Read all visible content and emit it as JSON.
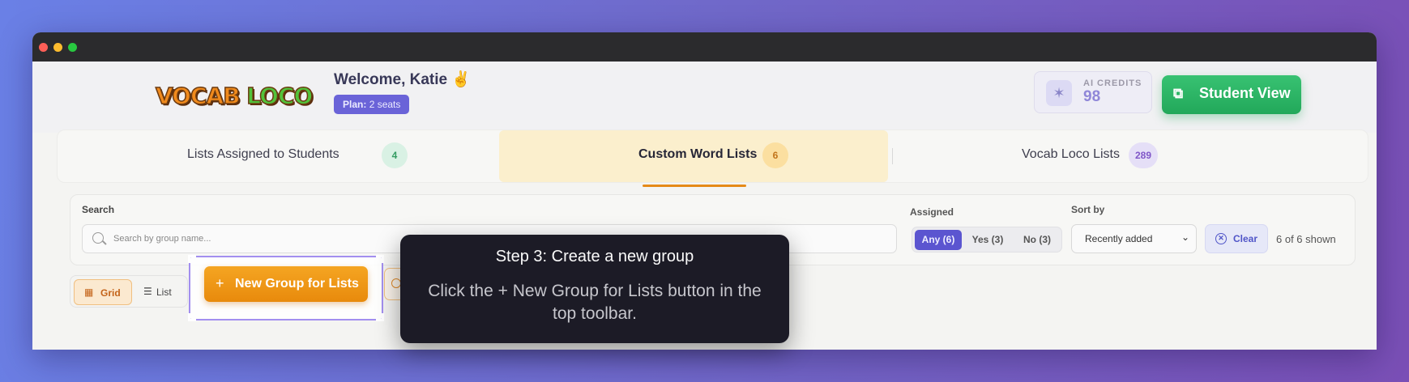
{
  "header": {
    "logo_text_1": "VOCAB",
    "logo_text_2": "LOCO",
    "welcome": "Welcome, Katie ✌️",
    "plan_label": "Plan:",
    "plan_value": "2 seats",
    "credits_label": "AI CREDITS",
    "credits_value": "98",
    "student_view_label": "Student View"
  },
  "tabs": [
    {
      "label": "Lists Assigned to Students",
      "count": "4"
    },
    {
      "label": "Custom Word Lists",
      "count": "6"
    },
    {
      "label": "Vocab Loco Lists",
      "count": "289"
    }
  ],
  "filters": {
    "search_label": "Search",
    "search_placeholder": "Search by group name...",
    "assigned_label": "Assigned",
    "assigned_options": [
      "Any (6)",
      "Yes (3)",
      "No (3)"
    ],
    "assigned_selected": "Any (6)",
    "sort_label": "Sort by",
    "sort_value": "Recently added",
    "clear_label": "Clear",
    "shown_text": "6 of 6 shown"
  },
  "toolbar": {
    "grid_label": "Grid",
    "list_label": "List",
    "new_group_label": "New Group for Lists"
  },
  "tooltip": {
    "title": "Step 3: Create a new group",
    "body": "Click the + New Group for Lists button in the top toolbar."
  },
  "colors": {
    "accent_orange": "#e88a0c",
    "accent_purple": "#5b55d0",
    "accent_green": "#22a85a"
  }
}
